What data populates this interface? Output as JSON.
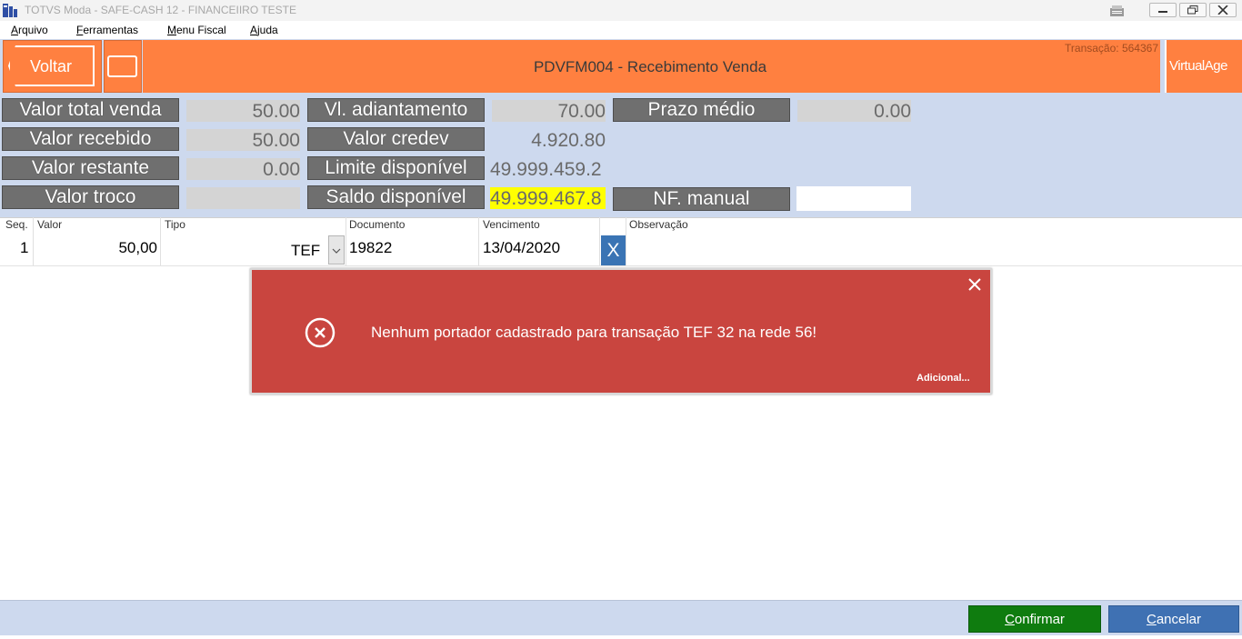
{
  "window": {
    "title": "TOTVS Moda - SAFE-CASH 12 - FINANCEIIRO TESTE"
  },
  "menu": {
    "arquivo_first": "A",
    "arquivo_rest": "rquivo",
    "ferramentas_first": "F",
    "ferramentas_rest": "erramentas",
    "menu_fiscal_first": "M",
    "menu_fiscal_rest": "enu Fiscal",
    "ajuda_first": "A",
    "ajuda_rest": "juda"
  },
  "header": {
    "back_label": "Voltar",
    "title": "PDVFM004 - Recebimento Venda",
    "transacao": "Transação: 564367",
    "right_label": "VirtualAge"
  },
  "summary": {
    "valor_total_venda_label": "Valor total venda",
    "valor_total_venda": "50.00",
    "valor_recebido_label": "Valor recebido",
    "valor_recebido": "50.00",
    "valor_restante_label": "Valor restante",
    "valor_restante": "0.00",
    "valor_troco_label": "Valor troco",
    "valor_troco": "",
    "vl_adiantamento_label": "Vl. adiantamento",
    "vl_adiantamento": "70.00",
    "valor_credev_label": "Valor credev",
    "valor_credev": "4.920.80",
    "limite_disponivel_label": "Limite disponível",
    "limite_disponivel": "49.999.459.2",
    "saldo_disponivel_label": "Saldo disponível",
    "saldo_disponivel": "49.999.467.8",
    "prazo_medio_label": "Prazo médio",
    "prazo_medio": "0.00",
    "nf_manual_label": "NF. manual",
    "nf_manual": ""
  },
  "grid": {
    "columns": [
      "Seq.",
      "Valor",
      "Tipo",
      "Documento",
      "Vencimento",
      "Observação"
    ],
    "rows": [
      {
        "seq": "1",
        "valor": "50,00",
        "tipo": "TEF",
        "documento": "19822",
        "vencimento": "13/04/2020",
        "observacao": "",
        "delete_label": "X"
      }
    ]
  },
  "error": {
    "message": "Nenhum portador cadastrado para transação TEF 32 na rede 56!",
    "details_link": "Adicional..."
  },
  "footer": {
    "confirm_first": "C",
    "confirm_rest": "onfirmar",
    "cancel_first": "C",
    "cancel_rest": "ancelar"
  },
  "colors": {
    "header_orange": "#ff8040",
    "panel_blue": "#cdd9ee",
    "error_red": "#c9453f",
    "confirm_green": "#0f7c0f",
    "cancel_blue": "#3f71b3",
    "highlight_yellow": "#ffff00"
  },
  "icons": [
    "app-icon",
    "tray-icon",
    "minimize-icon",
    "restore-icon",
    "close-icon",
    "card-icon",
    "chevron-down-icon",
    "error-icon",
    "close-popup-icon"
  ]
}
